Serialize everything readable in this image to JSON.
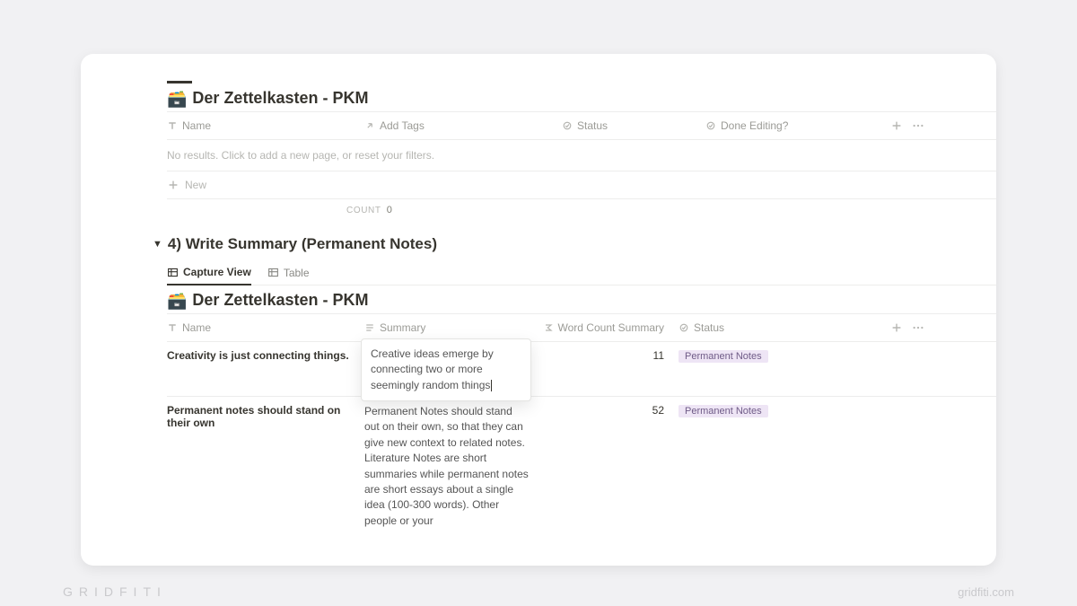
{
  "branding": {
    "left": "GRIDFITI",
    "right": "gridfiti.com"
  },
  "db1": {
    "title": "Der Zettelkasten - PKM",
    "columns": {
      "name": "Name",
      "tags": "Add Tags",
      "status": "Status",
      "done": "Done Editing?"
    },
    "emptyMessage": "No results. Click to add a new page, or reset your filters.",
    "newLabel": "New",
    "countLabel": "COUNT",
    "countValue": "0"
  },
  "section": {
    "heading": "4) Write Summary (Permanent Notes)"
  },
  "tabs": {
    "capture": "Capture View",
    "table": "Table"
  },
  "db2": {
    "title": "Der Zettelkasten - PKM",
    "columns": {
      "name": "Name",
      "summary": "Summary",
      "word": "Word Count Summary",
      "status": "Status"
    },
    "rows": [
      {
        "name": "Creativity is just connecting things.",
        "summary": "Creative ideas emerge by connecting two or more seemingly random things",
        "wordCount": "11",
        "status": "Permanent Notes"
      },
      {
        "name": "Permanent notes should stand on their own",
        "summary": "Permanent Notes should stand out on their own, so that they can give new context to related notes. Literature Notes are short summaries while permanent notes are short essays about a single idea (100-300 words). Other people or your",
        "wordCount": "52",
        "status": "Permanent Notes"
      }
    ]
  }
}
